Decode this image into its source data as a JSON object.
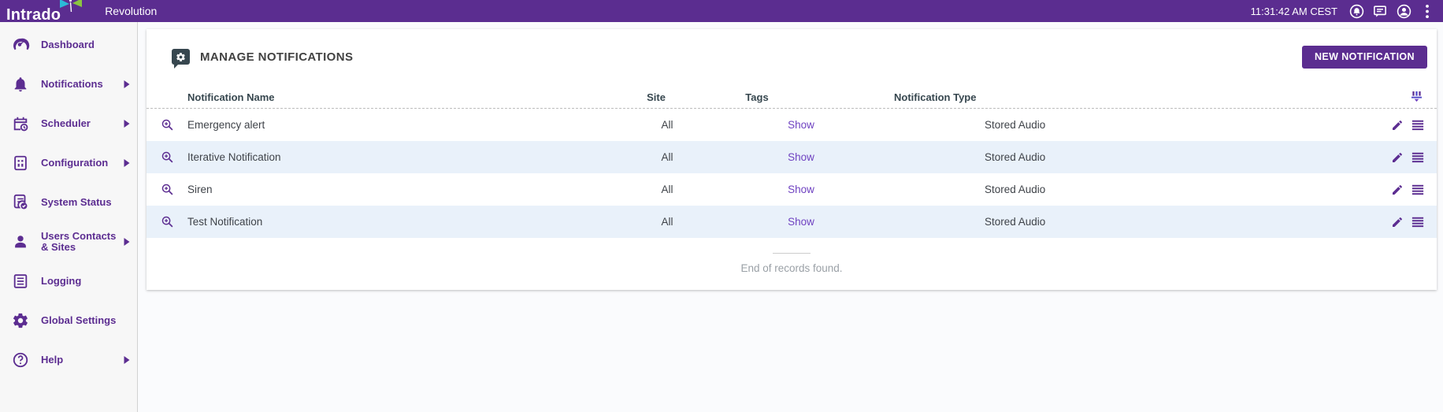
{
  "header": {
    "logo_text": "Intrado",
    "app_name": "Revolution",
    "clock": "11:31:42 AM CEST",
    "icons": [
      "alarm-icon",
      "messages-icon",
      "account-icon",
      "kebab-menu-icon"
    ]
  },
  "sidebar": {
    "items": [
      {
        "label": "Dashboard",
        "icon": "dashboard-gauge-icon",
        "has_submenu": false
      },
      {
        "label": "Notifications",
        "icon": "bell-icon",
        "has_submenu": true
      },
      {
        "label": "Scheduler",
        "icon": "calendar-clock-icon",
        "has_submenu": true
      },
      {
        "label": "Configuration",
        "icon": "control-panel-icon",
        "has_submenu": true
      },
      {
        "label": "System Status",
        "icon": "document-check-icon",
        "has_submenu": false
      },
      {
        "label": "Users Contacts & Sites",
        "icon": "person-icon",
        "has_submenu": true
      },
      {
        "label": "Logging",
        "icon": "log-list-icon",
        "has_submenu": false
      },
      {
        "label": "Global Settings",
        "icon": "gear-icon",
        "has_submenu": false
      },
      {
        "label": "Help",
        "icon": "help-circle-icon",
        "has_submenu": true
      }
    ]
  },
  "main": {
    "title": "MANAGE NOTIFICATIONS",
    "title_icon": "notification-settings-bubble-icon",
    "new_button_label": "NEW NOTIFICATION",
    "table": {
      "columns": [
        "Notification Name",
        "Site",
        "Tags",
        "Notification Type"
      ],
      "header_filter_icon": "column-filter-icon",
      "rows": [
        {
          "name": "Emergency alert",
          "site": "All",
          "tags": "Show",
          "type": "Stored Audio"
        },
        {
          "name": "Iterative Notification",
          "site": "All",
          "tags": "Show",
          "type": "Stored Audio"
        },
        {
          "name": "Siren",
          "site": "All",
          "tags": "Show",
          "type": "Stored Audio"
        },
        {
          "name": "Test Notification",
          "site": "All",
          "tags": "Show",
          "type": "Stored Audio"
        }
      ],
      "row_actions": [
        "edit-pencil-icon",
        "row-menu-icon"
      ],
      "row_zoom_icon": "zoom-in-magnifier-icon"
    },
    "end_message": "End of records found."
  },
  "colors": {
    "topbar_purple": "#5b2d90",
    "sidebar_purple": "#5c2d91",
    "link_purple": "#6f42c1",
    "alt_row_blue": "#e9f1fa",
    "title_icon_slate": "#37474f"
  }
}
